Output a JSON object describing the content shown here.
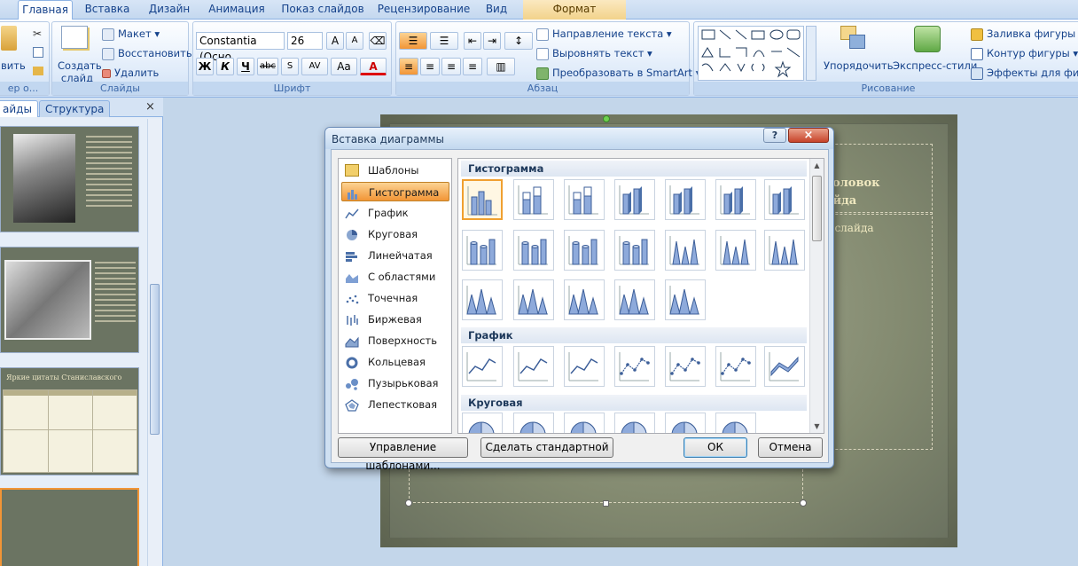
{
  "tabs": [
    "Главная",
    "Вставка",
    "Дизайн",
    "Анимация",
    "Показ слайдов",
    "Рецензирование",
    "Вид",
    "Формат"
  ],
  "clipboard": {
    "paste_label": "вить",
    "group_label": "ер о..."
  },
  "slides_group": {
    "create_label": "Создать слайд",
    "layout": "Макет",
    "reset": "Восстановить",
    "delete": "Удалить",
    "group_label": "Слайды"
  },
  "font_group": {
    "font_name": "Constantia (Осно",
    "font_size": "26",
    "group_label": "Шрифт",
    "bold": "Ж",
    "italic": "К",
    "underline": "Ч",
    "strike": "abc",
    "spacing": "AV",
    "case": "Aa",
    "color": "A"
  },
  "paragraph_group": {
    "text_direction": "Направление текста",
    "align_text": "Выровнять текст",
    "convert_smartart": "Преобразовать в SmartArt",
    "group_label": "Абзац"
  },
  "drawing_group": {
    "arrange": "Упорядочить",
    "quick_styles": "Экспресс-стили",
    "fill": "Заливка фигуры",
    "outline": "Контур фигуры",
    "effects": "Эффекты для фигур",
    "group_label": "Рисование"
  },
  "left_pane": {
    "tab_slides": "айды",
    "tab_outline": "Структура",
    "close": "×"
  },
  "slide": {
    "title_placeholder": "головок\nайда",
    "text_placeholder": "т слайда"
  },
  "thumb3_title": "Яркие цитаты Станиславского",
  "dialog": {
    "title": "Вставка диаграммы",
    "help": "?",
    "close": "×",
    "categories": [
      "Шаблоны",
      "Гистограмма",
      "График",
      "Круговая",
      "Линейчатая",
      "С областями",
      "Точечная",
      "Биржевая",
      "Поверхность",
      "Кольцевая",
      "Пузырьковая",
      "Лепестковая"
    ],
    "selected_category": "Гистограмма",
    "sections": [
      "Гистограмма",
      "График",
      "Круговая"
    ],
    "manage_templates": "Управление шаблонами...",
    "set_default": "Сделать стандартной",
    "ok": "ОК",
    "cancel": "Отмена"
  },
  "colors": {
    "accent": "#f29536",
    "ribbon": "#dbe7f6",
    "slide_bg": "#7b8269"
  }
}
